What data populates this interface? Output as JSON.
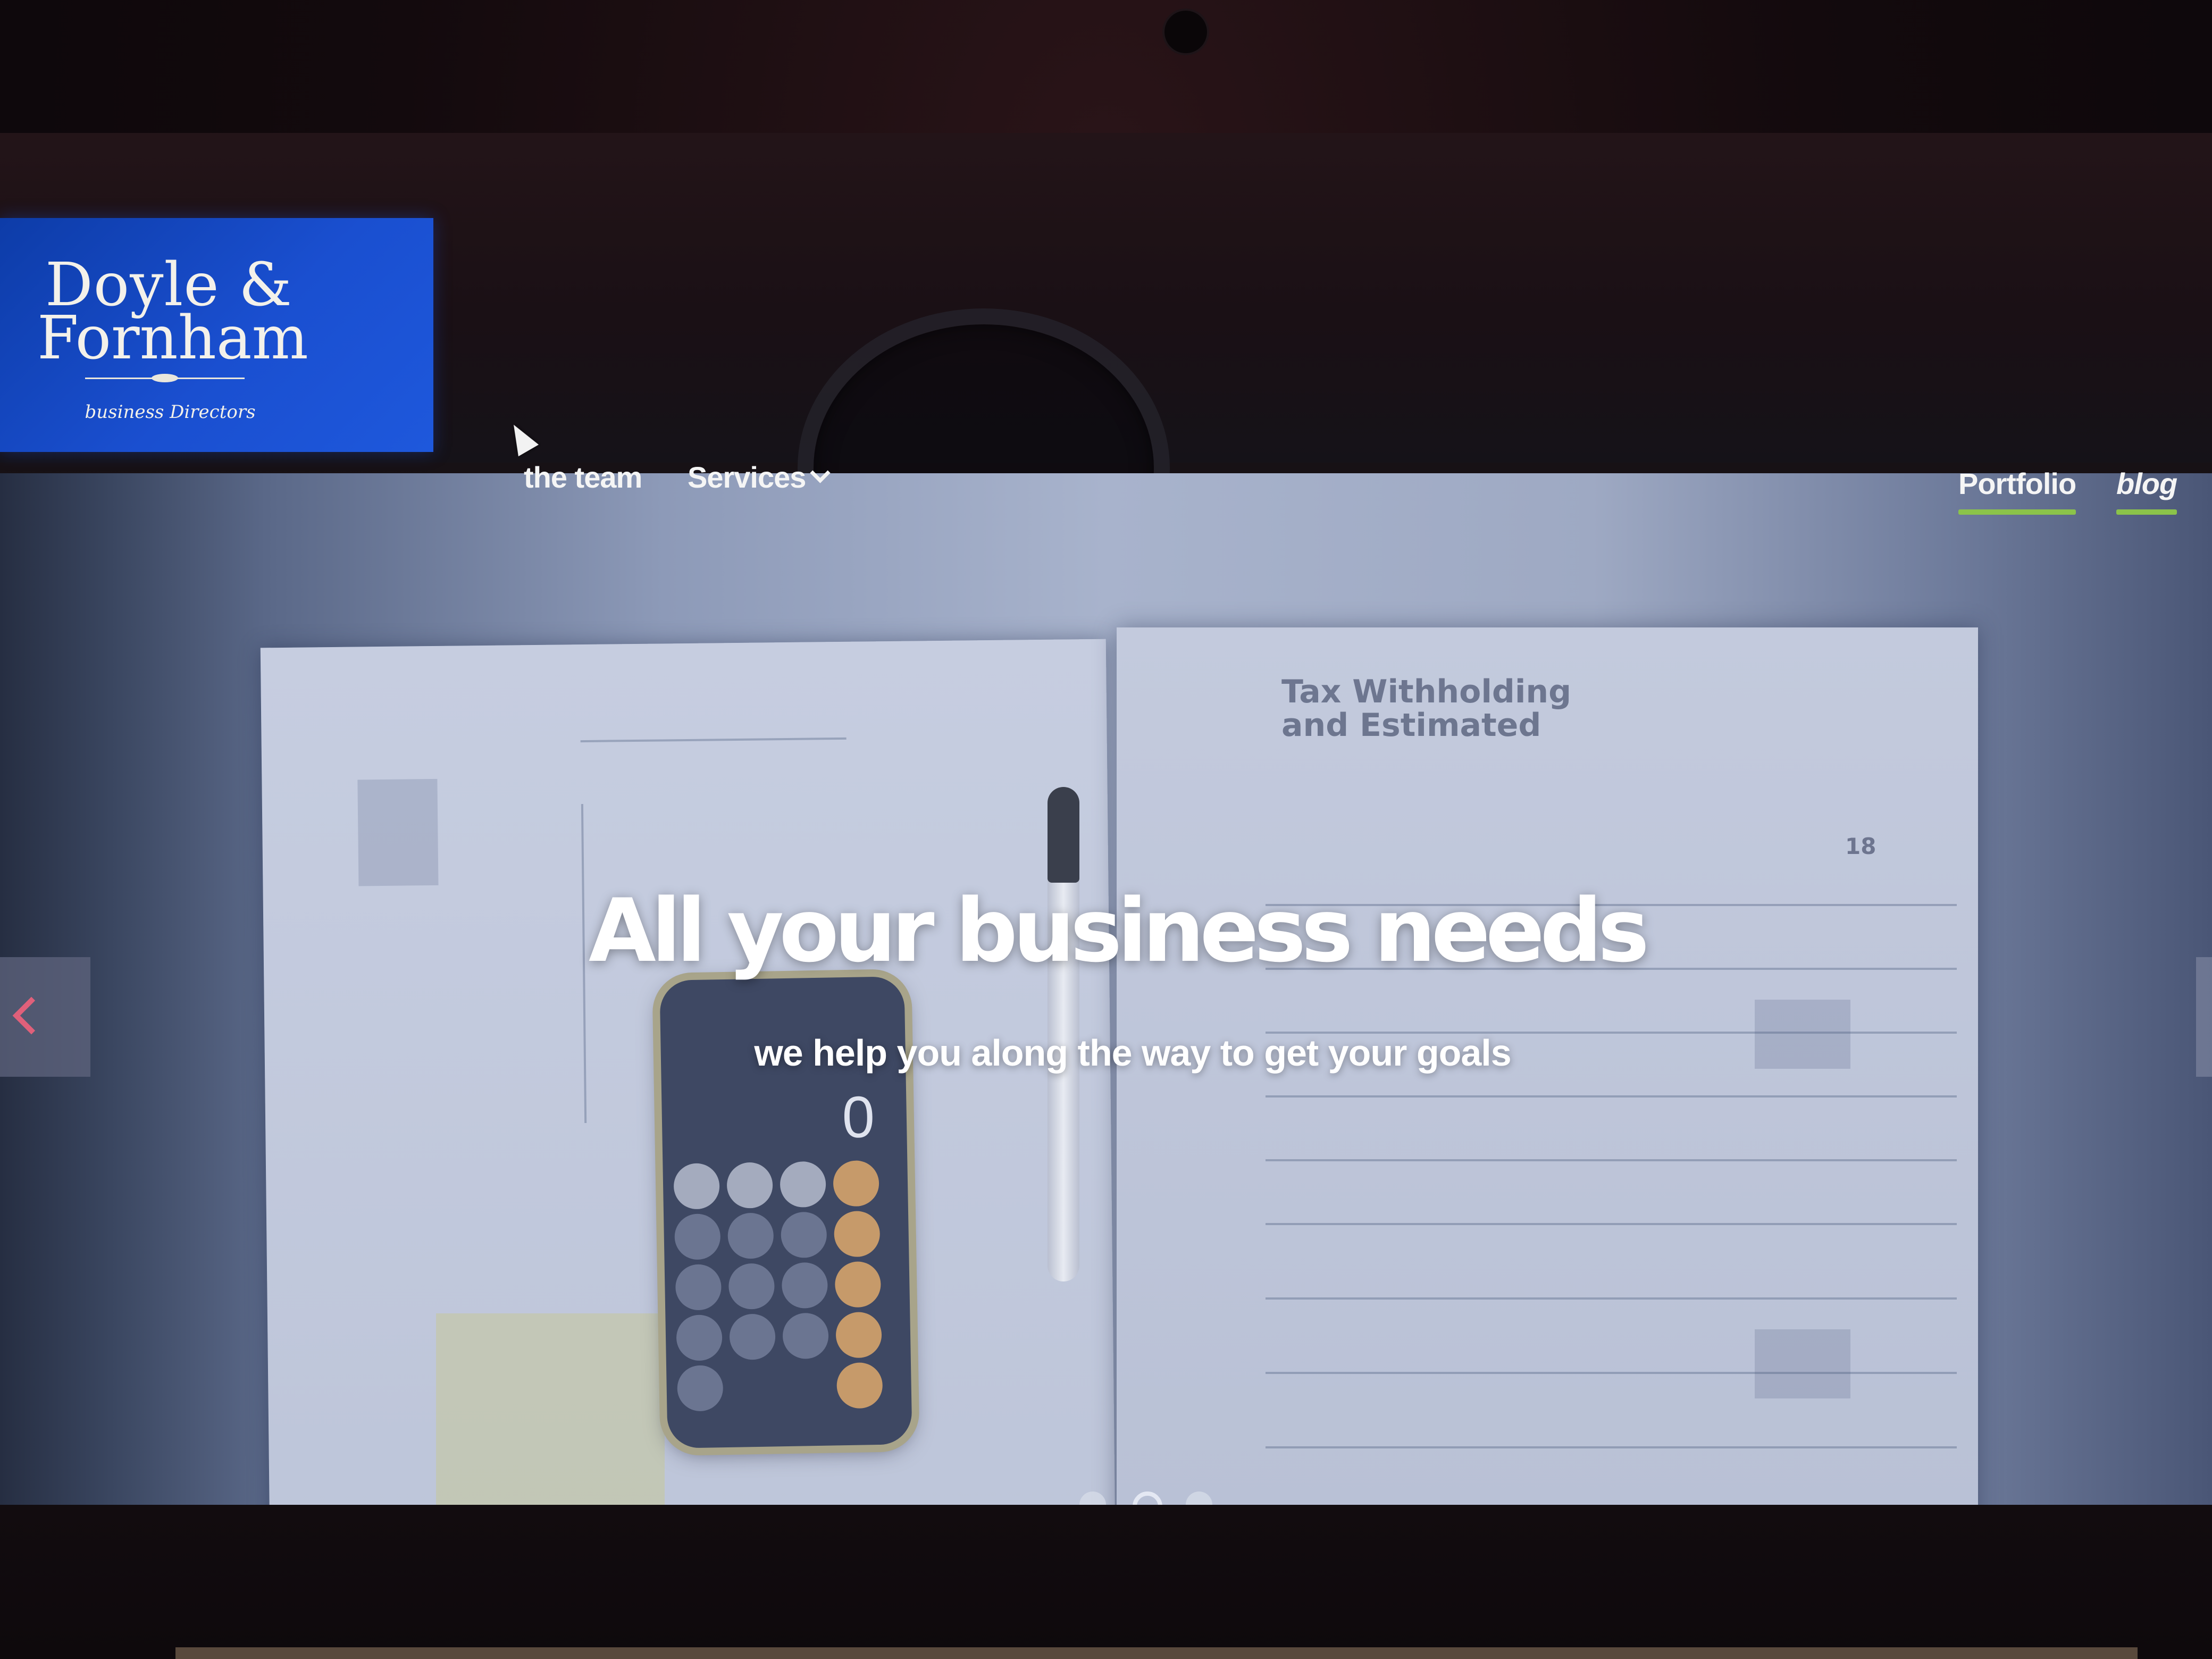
{
  "logo": {
    "line1": "Doyle &",
    "line2": "Fornham",
    "tagline": "business Directors"
  },
  "nav": {
    "team": "the team",
    "services": "Services",
    "portfolio": "Portfolio",
    "blog": "blog"
  },
  "hero": {
    "title": "All your business needs",
    "subtitle": "we help you along the way to get your goals"
  },
  "background_doc": {
    "heading": "Tax Withholding and Estimated",
    "year": "18",
    "phone_display": "0"
  },
  "carousel": {
    "active_slide": 2,
    "total_slides": 3
  },
  "colors": {
    "logo_blue": "#1a4fd0",
    "nav_underline": "#8bc34a",
    "arrow_accent": "#e0607a"
  },
  "icons": {
    "prev": "chevron-left-icon",
    "services_dropdown": "chevron-down-icon",
    "cursor": "mouse-pointer-icon"
  }
}
